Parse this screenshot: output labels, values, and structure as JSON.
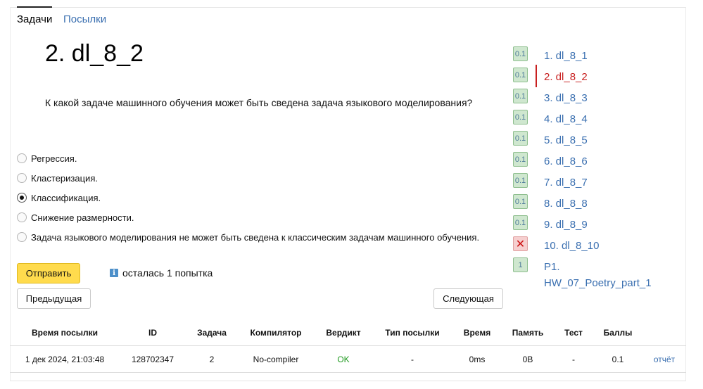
{
  "tabs": [
    {
      "label": "Задачи",
      "active": true
    },
    {
      "label": "Посылки",
      "active": false
    }
  ],
  "problem": {
    "title": "2. dl_8_2",
    "question": "К какой задаче машинного обучения может быть сведена задача языкового моделирования?"
  },
  "options": [
    {
      "label": "Регрессия.",
      "checked": false
    },
    {
      "label": "Кластеризация.",
      "checked": false
    },
    {
      "label": "Классификация.",
      "checked": true
    },
    {
      "label": "Снижение размерности.",
      "checked": false
    },
    {
      "label": "Задача языкового моделирования не может быть сведена к классическим задачам машинного обучения.",
      "checked": false
    }
  ],
  "actions": {
    "submit_label": "Отправить",
    "attempts_icon": "i",
    "attempts_text": "осталась 1 попытка",
    "prev_label": "Предыдущая",
    "next_label": "Следующая"
  },
  "problem_list": [
    {
      "badge": "0.1",
      "label": "1. dl_8_1",
      "status": "ok"
    },
    {
      "badge": "0.1",
      "label": "2. dl_8_2",
      "status": "ok",
      "current": true
    },
    {
      "badge": "0.1",
      "label": "3. dl_8_3",
      "status": "ok"
    },
    {
      "badge": "0.1",
      "label": "4. dl_8_4",
      "status": "ok"
    },
    {
      "badge": "0.1",
      "label": "5. dl_8_5",
      "status": "ok"
    },
    {
      "badge": "0.1",
      "label": "6. dl_8_6",
      "status": "ok"
    },
    {
      "badge": "0.1",
      "label": "7. dl_8_7",
      "status": "ok"
    },
    {
      "badge": "0.1",
      "label": "8. dl_8_8",
      "status": "ok"
    },
    {
      "badge": "0.1",
      "label": "9. dl_8_9",
      "status": "ok"
    },
    {
      "badge": "✕",
      "label": "10. dl_8_10",
      "status": "fail"
    },
    {
      "badge": "1",
      "label": "P1.",
      "label2": "HW_07_Poetry_part_1",
      "status": "ok"
    }
  ],
  "submissions": {
    "columns": [
      "Время посылки",
      "ID",
      "Задача",
      "Компилятор",
      "Вердикт",
      "Тип посылки",
      "Время",
      "Память",
      "Тест",
      "Баллы"
    ],
    "rows": [
      {
        "time": "1 дек 2024, 21:03:48",
        "id": "128702347",
        "task": "2",
        "compiler": "No-compiler",
        "verdict": "OK",
        "type": "-",
        "run_time": "0ms",
        "memory": "0B",
        "test": "-",
        "score": "0.1",
        "report": "отчёт"
      }
    ]
  },
  "colors": {
    "link": "#3a6fb0",
    "current": "#c82020",
    "ok_verdict": "#1f9a1f",
    "submit_button": "#ffdb4d",
    "badge_ok_bg": "#cfe7cf",
    "badge_fail_bg": "#f6cfcf"
  }
}
